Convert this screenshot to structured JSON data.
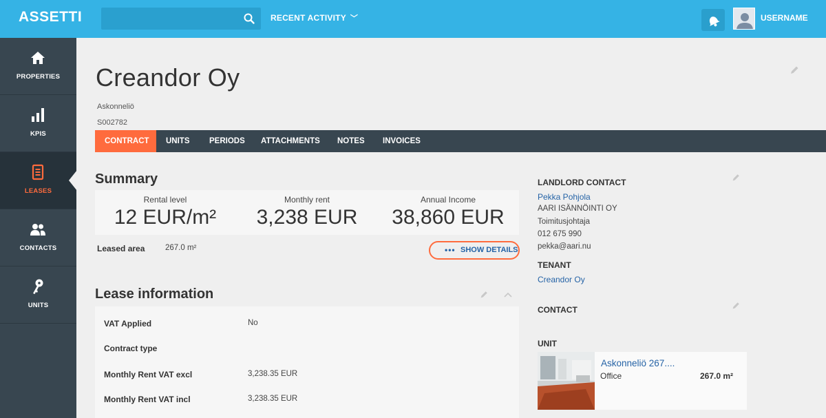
{
  "topbar": {
    "logo": "ASSETTI",
    "search_placeholder": "",
    "recent_activity": "RECENT ACTIVITY",
    "username": "USERNAME"
  },
  "sidebar": {
    "items": [
      {
        "label": "PROPERTIES",
        "icon": "home-icon"
      },
      {
        "label": "KPIS",
        "icon": "bar-chart-icon"
      },
      {
        "label": "LEASES",
        "icon": "document-icon"
      },
      {
        "label": "CONTACTS",
        "icon": "people-icon"
      },
      {
        "label": "UNITS",
        "icon": "key-icon"
      }
    ],
    "active": "LEASES"
  },
  "page": {
    "title": "Creandor Oy",
    "subtitle": "Askonneliö",
    "code": "S002782"
  },
  "tabs": [
    "CONTRACT",
    "UNITS",
    "PERIODS",
    "ATTACHMENTS",
    "NOTES",
    "INVOICES"
  ],
  "summary": {
    "heading": "Summary",
    "kpis": [
      {
        "label": "Rental level",
        "value": "12 EUR/m²"
      },
      {
        "label": "Monthly rent",
        "value": "3,238 EUR"
      },
      {
        "label": "Annual Income",
        "value": "38,860 EUR"
      }
    ],
    "leased_area_label": "Leased area",
    "leased_area_value": "267.0 m²",
    "show_details": "SHOW DETAILS"
  },
  "lease_info": {
    "heading": "Lease information",
    "rows": [
      {
        "label": "VAT Applied",
        "value": "No"
      },
      {
        "label": "Contract type",
        "value": ""
      },
      {
        "label": "Monthly Rent VAT excl",
        "value": "3,238.35 EUR"
      },
      {
        "label": "Monthly Rent VAT incl",
        "value": "3,238.35 EUR"
      }
    ]
  },
  "right_panel": {
    "landlord_heading": "LANDLORD CONTACT",
    "landlord_name": "Pekka Pohjola",
    "landlord_company": "AARI ISÄNNÖINTI OY",
    "landlord_role": "Toimitusjohtaja",
    "landlord_phone": "012 675 990",
    "landlord_email": "pekka@aari.nu",
    "tenant_heading": "TENANT",
    "tenant_name": "Creandor Oy",
    "contact_heading": "CONTACT",
    "unit_heading": "UNIT",
    "unit_name": "Askonneliö 267....",
    "unit_type": "Office",
    "unit_area": "267.0  m²"
  },
  "colors": {
    "topbar": "#35b3e5",
    "sidebar": "#384650",
    "accent": "#ff6b3d",
    "link": "#2563a6"
  }
}
